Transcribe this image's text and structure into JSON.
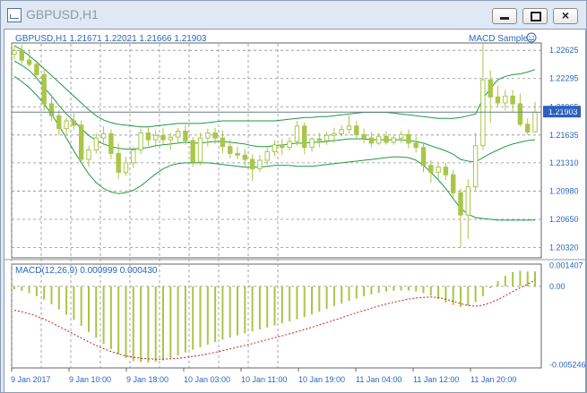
{
  "window": {
    "title": "GBPUSD,H1",
    "icon": "chart-window-icon",
    "buttons": [
      "minimize-icon",
      "maximize-icon",
      "close-icon"
    ],
    "close_glyph": "×"
  },
  "colors": {
    "candle": "#a9c648",
    "bands": "#1f9a43",
    "grid": "#8f8f8f",
    "text": "#2a66bf",
    "signal": "#d11b1b",
    "price_line": "#6c7f8a",
    "current_tag_bg": "#2d5fbf"
  },
  "chart_data": [
    {
      "type": "candlestick",
      "title": "GBPUSD,H1  1.21671 1.22021 1.21666 1.21903",
      "indicator_label": "MACD Sample",
      "current_price": 1.21903,
      "ylim": [
        1.202,
        1.227
      ],
      "y_ticks": [
        1.22625,
        1.22295,
        1.21965,
        1.21635,
        1.2131,
        1.2098,
        1.2065,
        1.2032
      ],
      "y_tick_labels": [
        "1.22625",
        "1.22295",
        "1.21965",
        "1.21635",
        "1.21310",
        "1.20980",
        "1.20650",
        "1.20320"
      ],
      "x_tick_labels": [
        "9 Jan 2017",
        "9 Jan 10:00",
        "9 Jan 18:00",
        "10 Jan 03:00",
        "10 Jan 11:00",
        "10 Jan 19:00",
        "11 Jan 04:00",
        "11 Jan 12:00",
        "11 Jan 20:00"
      ],
      "candles_ohlc": [
        [
          1.2258,
          1.2268,
          1.2252,
          1.2262
        ],
        [
          1.2262,
          1.2269,
          1.2247,
          1.2251
        ],
        [
          1.2251,
          1.2263,
          1.2243,
          1.2246
        ],
        [
          1.2246,
          1.2251,
          1.2228,
          1.2234
        ],
        [
          1.2234,
          1.2241,
          1.2192,
          1.22
        ],
        [
          1.22,
          1.2211,
          1.218,
          1.2186
        ],
        [
          1.2186,
          1.2193,
          1.2163,
          1.2171
        ],
        [
          1.2171,
          1.2184,
          1.2164,
          1.218
        ],
        [
          1.218,
          1.2189,
          1.217,
          1.2175
        ],
        [
          1.2175,
          1.218,
          1.213,
          1.2135
        ],
        [
          1.2135,
          1.2151,
          1.2126,
          1.2146
        ],
        [
          1.2146,
          1.2166,
          1.2142,
          1.216
        ],
        [
          1.216,
          1.2174,
          1.2152,
          1.2165
        ],
        [
          1.2165,
          1.217,
          1.2135,
          1.2142
        ],
        [
          1.2142,
          1.2154,
          1.2112,
          1.212
        ],
        [
          1.212,
          1.2138,
          1.2116,
          1.2131
        ],
        [
          1.2131,
          1.215,
          1.2125,
          1.2146
        ],
        [
          1.2146,
          1.2171,
          1.2141,
          1.2166
        ],
        [
          1.2166,
          1.2172,
          1.2151,
          1.2158
        ],
        [
          1.2158,
          1.2169,
          1.2149,
          1.2163
        ],
        [
          1.2163,
          1.2172,
          1.2152,
          1.2158
        ],
        [
          1.2158,
          1.2166,
          1.2146,
          1.2161
        ],
        [
          1.2161,
          1.2172,
          1.2154,
          1.2168
        ],
        [
          1.2168,
          1.2175,
          1.2152,
          1.2157
        ],
        [
          1.2157,
          1.2161,
          1.2126,
          1.2132
        ],
        [
          1.2132,
          1.2166,
          1.2128,
          1.216
        ],
        [
          1.216,
          1.2171,
          1.215,
          1.2166
        ],
        [
          1.2166,
          1.2172,
          1.2153,
          1.216
        ],
        [
          1.216,
          1.2169,
          1.2142,
          1.215
        ],
        [
          1.215,
          1.2158,
          1.2136,
          1.2142
        ],
        [
          1.2142,
          1.215,
          1.2135,
          1.214
        ],
        [
          1.214,
          1.2147,
          1.2126,
          1.2135
        ],
        [
          1.2135,
          1.2141,
          1.211,
          1.2124
        ],
        [
          1.2124,
          1.214,
          1.212,
          1.2134
        ],
        [
          1.2134,
          1.2149,
          1.2129,
          1.2144
        ],
        [
          1.2144,
          1.2157,
          1.2139,
          1.2152
        ],
        [
          1.2152,
          1.2159,
          1.214,
          1.2149
        ],
        [
          1.2149,
          1.2161,
          1.2145,
          1.2156
        ],
        [
          1.2156,
          1.218,
          1.2151,
          1.2174
        ],
        [
          1.2174,
          1.2178,
          1.2141,
          1.2149
        ],
        [
          1.2149,
          1.2161,
          1.2144,
          1.2159
        ],
        [
          1.2159,
          1.2166,
          1.2149,
          1.2157
        ],
        [
          1.2157,
          1.2167,
          1.2152,
          1.2163
        ],
        [
          1.2163,
          1.2172,
          1.2154,
          1.2165
        ],
        [
          1.2165,
          1.2175,
          1.2162,
          1.217
        ],
        [
          1.217,
          1.2186,
          1.2165,
          1.2174
        ],
        [
          1.2174,
          1.218,
          1.216,
          1.2164
        ],
        [
          1.2164,
          1.2171,
          1.2154,
          1.216
        ],
        [
          1.216,
          1.2167,
          1.2149,
          1.2154
        ],
        [
          1.2154,
          1.2166,
          1.2152,
          1.2162
        ],
        [
          1.2162,
          1.2168,
          1.2152,
          1.2155
        ],
        [
          1.2155,
          1.2164,
          1.2152,
          1.216
        ],
        [
          1.216,
          1.2168,
          1.2154,
          1.2164
        ],
        [
          1.2164,
          1.217,
          1.2148,
          1.2154
        ],
        [
          1.2154,
          1.2162,
          1.2143,
          1.2149
        ],
        [
          1.2149,
          1.2154,
          1.212,
          1.2128
        ],
        [
          1.2128,
          1.2134,
          1.2108,
          1.212
        ],
        [
          1.212,
          1.2131,
          1.2112,
          1.2126
        ],
        [
          1.2126,
          1.2131,
          1.2111,
          1.2117
        ],
        [
          1.2117,
          1.2123,
          1.209,
          1.2096
        ],
        [
          1.2096,
          1.2101,
          1.2032,
          1.207
        ],
        [
          1.207,
          1.2112,
          1.2042,
          1.2103
        ],
        [
          1.2103,
          1.2166,
          1.2098,
          1.2151
        ],
        [
          1.2151,
          1.227,
          1.2146,
          1.2228
        ],
        [
          1.2228,
          1.2239,
          1.2178,
          1.2208
        ],
        [
          1.2208,
          1.2221,
          1.2196,
          1.2201
        ],
        [
          1.2201,
          1.2216,
          1.2192,
          1.2209
        ],
        [
          1.2209,
          1.2216,
          1.219,
          1.22
        ],
        [
          1.22,
          1.2212,
          1.2173,
          1.2176
        ],
        [
          1.2176,
          1.2183,
          1.2164,
          1.2167
        ],
        [
          1.2167,
          1.2202,
          1.2167,
          1.219
        ]
      ],
      "upper_band": [
        1.2268,
        1.2263,
        1.2256,
        1.2249,
        1.2241,
        1.2233,
        1.2225,
        1.2217,
        1.2209,
        1.2201,
        1.2193,
        1.2186,
        1.2181,
        1.2178,
        1.2176,
        1.2175,
        1.2174,
        1.2173,
        1.2173,
        1.2174,
        1.2175,
        1.2176,
        1.2177,
        1.2177,
        1.2177,
        1.2177,
        1.2178,
        1.2179,
        1.218,
        1.218,
        1.218,
        1.218,
        1.218,
        1.218,
        1.218,
        1.218,
        1.2181,
        1.2182,
        1.2183,
        1.2184,
        1.2184,
        1.2185,
        1.2185,
        1.2186,
        1.2187,
        1.2188,
        1.2189,
        1.219,
        1.219,
        1.219,
        1.219,
        1.2189,
        1.2188,
        1.2187,
        1.2186,
        1.2185,
        1.2184,
        1.2183,
        1.2183,
        1.2183,
        1.2184,
        1.2186,
        1.2188,
        1.2206,
        1.2218,
        1.2228,
        1.2232,
        1.2234,
        1.2235,
        1.2237,
        1.224
      ],
      "middle_band": [
        1.225,
        1.2245,
        1.2239,
        1.223,
        1.2219,
        1.2209,
        1.2198,
        1.2188,
        1.218,
        1.2171,
        1.2163,
        1.2157,
        1.2153,
        1.215,
        1.2148,
        1.2147,
        1.2147,
        1.2148,
        1.2149,
        1.2151,
        1.2152,
        1.2153,
        1.2154,
        1.2155,
        1.2154,
        1.2154,
        1.2155,
        1.2156,
        1.2156,
        1.2155,
        1.2154,
        1.2153,
        1.2151,
        1.215,
        1.215,
        1.2151,
        1.2152,
        1.2153,
        1.2154,
        1.2154,
        1.2155,
        1.2155,
        1.2156,
        1.2157,
        1.2158,
        1.2159,
        1.2159,
        1.2159,
        1.2158,
        1.2158,
        1.2158,
        1.2158,
        1.2158,
        1.2157,
        1.2156,
        1.2154,
        1.2151,
        1.2148,
        1.2145,
        1.2141,
        1.2135,
        1.2133,
        1.2132,
        1.2137,
        1.2142,
        1.2146,
        1.215,
        1.2153,
        1.2155,
        1.2157,
        1.2158
      ],
      "lower_band": [
        1.2232,
        1.2226,
        1.2219,
        1.221,
        1.22,
        1.2188,
        1.2174,
        1.216,
        1.2145,
        1.2131,
        1.2118,
        1.2108,
        1.2101,
        1.2097,
        1.2095,
        1.2096,
        1.2099,
        1.2104,
        1.2111,
        1.2118,
        1.2124,
        1.2128,
        1.213,
        1.2131,
        1.2131,
        1.2131,
        1.2131,
        1.213,
        1.2129,
        1.2128,
        1.2127,
        1.2126,
        1.2126,
        1.2126,
        1.2127,
        1.2128,
        1.2128,
        1.2128,
        1.2127,
        1.2127,
        1.2127,
        1.2128,
        1.2129,
        1.213,
        1.2131,
        1.2132,
        1.2133,
        1.2134,
        1.2135,
        1.2136,
        1.2137,
        1.2138,
        1.2138,
        1.2137,
        1.2134,
        1.2128,
        1.212,
        1.2111,
        1.2101,
        1.2089,
        1.2078,
        1.2071,
        1.2067,
        1.2066,
        1.2065,
        1.2064,
        1.2064,
        1.2064,
        1.2064,
        1.2064,
        1.2064
      ]
    },
    {
      "type": "histogram",
      "title": "MACD(12,26,9) 0.000999 0.000430",
      "ylim": [
        -0.00546,
        0.00143
      ],
      "y_ticks": [
        0.001407,
        0.0,
        -0.005246
      ],
      "y_tick_labels": [
        "0.001407",
        "0.00",
        "-0.005246"
      ],
      "macd_histogram": [
        -0.0002,
        -0.0003,
        -0.00045,
        -0.00065,
        -0.0009,
        -0.0012,
        -0.00155,
        -0.0019,
        -0.00225,
        -0.00265,
        -0.00305,
        -0.00345,
        -0.00385,
        -0.0042,
        -0.00455,
        -0.0048,
        -0.005,
        -0.00508,
        -0.0051,
        -0.00505,
        -0.00495,
        -0.0048,
        -0.00462,
        -0.00443,
        -0.00425,
        -0.00407,
        -0.0039,
        -0.00373,
        -0.00357,
        -0.00342,
        -0.00328,
        -0.00314,
        -0.00301,
        -0.00288,
        -0.00275,
        -0.00262,
        -0.00248,
        -0.00234,
        -0.0022,
        -0.00205,
        -0.00188,
        -0.0017,
        -0.00152,
        -0.00133,
        -0.00115,
        -0.00098,
        -0.00082,
        -0.00067,
        -0.00054,
        -0.00043,
        -0.00035,
        -0.0003,
        -0.00028,
        -0.00029,
        -0.00034,
        -0.00045,
        -0.00062,
        -0.00085,
        -0.00108,
        -0.00125,
        -0.00138,
        -0.0013,
        -0.00105,
        -0.00065,
        -0.00012,
        0.00035,
        0.0007,
        0.00095,
        0.00105,
        0.001,
        0.001
      ],
      "signal_line": [
        -0.0016,
        -0.0017,
        -0.00183,
        -0.00199,
        -0.00219,
        -0.00243,
        -0.00268,
        -0.00294,
        -0.0032,
        -0.00346,
        -0.00371,
        -0.00395,
        -0.00417,
        -0.00436,
        -0.00452,
        -0.00465,
        -0.00474,
        -0.00481,
        -0.00485,
        -0.00487,
        -0.00487,
        -0.00485,
        -0.00481,
        -0.00476,
        -0.00469,
        -0.00461,
        -0.00452,
        -0.00442,
        -0.00431,
        -0.00419,
        -0.00407,
        -0.00395,
        -0.00383,
        -0.0037,
        -0.00357,
        -0.00344,
        -0.00331,
        -0.00318,
        -0.00304,
        -0.00289,
        -0.00274,
        -0.00258,
        -0.00242,
        -0.00226,
        -0.0021,
        -0.00193,
        -0.00177,
        -0.00162,
        -0.00146,
        -0.00132,
        -0.00118,
        -0.00106,
        -0.00095,
        -0.00085,
        -0.00078,
        -0.00074,
        -0.00071,
        -0.00075,
        -0.00086,
        -0.001,
        -0.00116,
        -0.00128,
        -0.00133,
        -0.00126,
        -0.0011,
        -0.00088,
        -0.00062,
        -0.00035,
        -0.0001,
        0.00015,
        0.00043
      ]
    }
  ]
}
